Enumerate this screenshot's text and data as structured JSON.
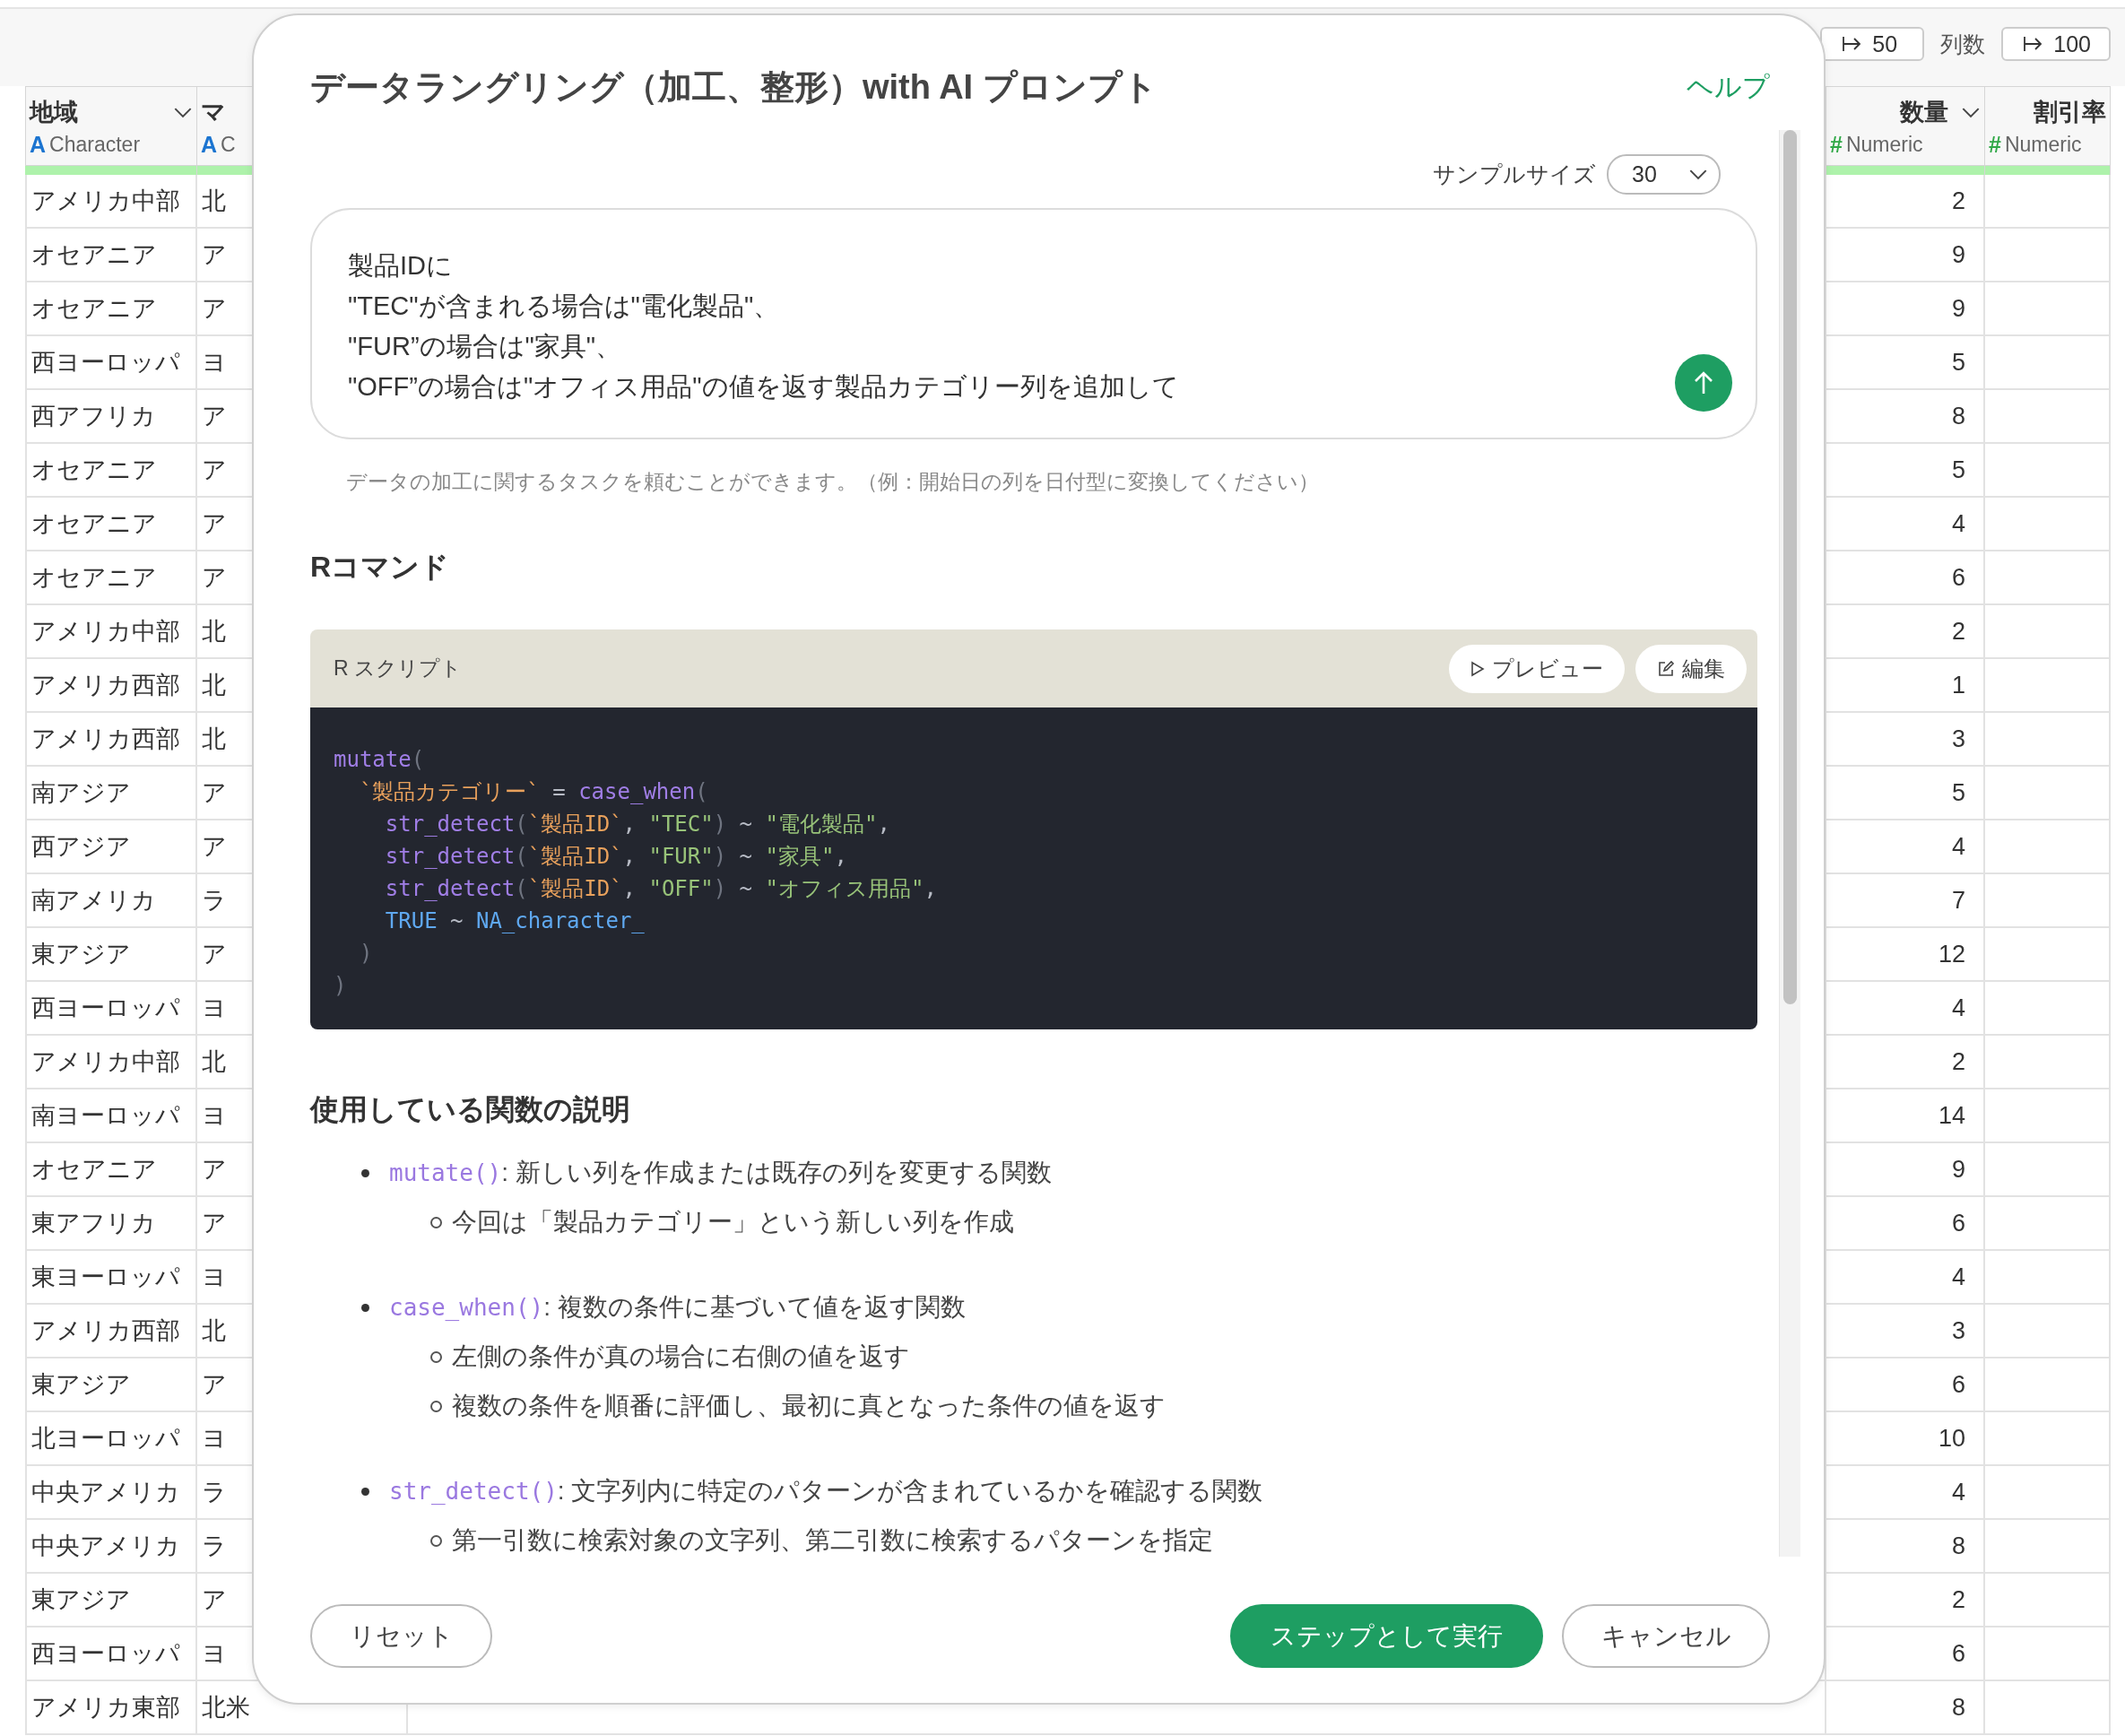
{
  "toolbar": {
    "rows_button": "50",
    "columns_label": "列数",
    "columns_button": "100"
  },
  "table": {
    "columns": [
      {
        "name": "地域",
        "type_icon": "A",
        "type": "Character",
        "kind": "character",
        "menu": true
      },
      {
        "name": "マ",
        "type_icon": "A",
        "type": "C",
        "kind": "character"
      },
      {
        "name": "数量",
        "type_icon": "#",
        "type": "Numeric",
        "kind": "numeric",
        "menu": true
      },
      {
        "name": "割引率",
        "type_icon": "#",
        "type": "Numeric",
        "kind": "numeric"
      }
    ],
    "rows": [
      [
        "アメリカ中部",
        "北",
        "2"
      ],
      [
        "オセアニア",
        "ア",
        "9"
      ],
      [
        "オセアニア",
        "ア",
        "9"
      ],
      [
        "西ヨーロッパ",
        "ヨ",
        "5"
      ],
      [
        "西アフリカ",
        "ア",
        "8"
      ],
      [
        "オセアニア",
        "ア",
        "5"
      ],
      [
        "オセアニア",
        "ア",
        "4"
      ],
      [
        "オセアニア",
        "ア",
        "6"
      ],
      [
        "アメリカ中部",
        "北",
        "2"
      ],
      [
        "アメリカ西部",
        "北",
        "1"
      ],
      [
        "アメリカ西部",
        "北",
        "3"
      ],
      [
        "南アジア",
        "ア",
        "5"
      ],
      [
        "西アジア",
        "ア",
        "4"
      ],
      [
        "南アメリカ",
        "ラ",
        "7"
      ],
      [
        "東アジア",
        "ア",
        "12"
      ],
      [
        "西ヨーロッパ",
        "ヨ",
        "4"
      ],
      [
        "アメリカ中部",
        "北",
        "2"
      ],
      [
        "南ヨーロッパ",
        "ヨ",
        "14"
      ],
      [
        "オセアニア",
        "ア",
        "9"
      ],
      [
        "東アフリカ",
        "ア",
        "6"
      ],
      [
        "東ヨーロッパ",
        "ヨ",
        "4"
      ],
      [
        "アメリカ西部",
        "北",
        "3"
      ],
      [
        "東アジア",
        "ア",
        "6"
      ],
      [
        "北ヨーロッパ",
        "ヨ",
        "10"
      ],
      [
        "中央アメリカ",
        "ラ",
        "4"
      ],
      [
        "中央アメリカ",
        "ラ",
        "8"
      ],
      [
        "東アジア",
        "ア",
        "2"
      ],
      [
        "西ヨーロッパ",
        "ヨ",
        "6"
      ],
      [
        "アメリカ東部",
        "北米",
        "8"
      ]
    ]
  },
  "dialog": {
    "title": "データラングリング（加工、整形）with AI プロンプト",
    "help_link": "ヘルプ",
    "sample_size": {
      "label": "サンプルサイズ",
      "value": "30"
    },
    "prompt": {
      "value": "製品IDに\n\"TEC\"が含まれる場合は\"電化製品\"、\n\"FUR”の場合は\"家具\"、\n\"OFF”の場合は\"オフィス用品\"の値を返す製品カテゴリー列を追加して"
    },
    "hint": "データの加工に関するタスクを頼むことができます。（例：開始日の列を日付型に変換してください）",
    "r_command": {
      "heading": "Rコマンド",
      "script_label": "R スクリプト",
      "buttons": [
        {
          "label": "プレビュー",
          "kind": "preview"
        },
        {
          "label": "編集",
          "kind": "edit"
        }
      ],
      "code": [
        [
          {
            "kind": "fn",
            "text": "mutate"
          },
          {
            "kind": "punct",
            "text": "("
          }
        ],
        [
          {
            "kind": "name",
            "text": "  `製品カテゴリー`"
          },
          {
            "kind": "op",
            "text": " = "
          },
          {
            "kind": "fn",
            "text": "case_when"
          },
          {
            "kind": "punct",
            "text": "("
          }
        ],
        [
          {
            "kind": "fn",
            "text": "    str_detect"
          },
          {
            "kind": "punct",
            "text": "("
          },
          {
            "kind": "name",
            "text": "`製品ID`"
          },
          {
            "kind": "op",
            "text": ", "
          },
          {
            "kind": "str",
            "text": "\"TEC\""
          },
          {
            "kind": "punct",
            "text": ")"
          },
          {
            "kind": "op",
            "text": " ~ "
          },
          {
            "kind": "str",
            "text": "\"電化製品\""
          },
          {
            "kind": "op",
            "text": ","
          }
        ],
        [
          {
            "kind": "fn",
            "text": "    str_detect"
          },
          {
            "kind": "punct",
            "text": "("
          },
          {
            "kind": "name",
            "text": "`製品ID`"
          },
          {
            "kind": "op",
            "text": ", "
          },
          {
            "kind": "str",
            "text": "\"FUR\""
          },
          {
            "kind": "punct",
            "text": ")"
          },
          {
            "kind": "op",
            "text": " ~ "
          },
          {
            "kind": "str",
            "text": "\"家具\""
          },
          {
            "kind": "op",
            "text": ","
          }
        ],
        [
          {
            "kind": "fn",
            "text": "    str_detect"
          },
          {
            "kind": "punct",
            "text": "("
          },
          {
            "kind": "name",
            "text": "`製品ID`"
          },
          {
            "kind": "op",
            "text": ", "
          },
          {
            "kind": "str",
            "text": "\"OFF\""
          },
          {
            "kind": "punct",
            "text": ")"
          },
          {
            "kind": "op",
            "text": " ~ "
          },
          {
            "kind": "str",
            "text": "\"オフィス用品\""
          },
          {
            "kind": "op",
            "text": ","
          }
        ],
        [
          {
            "kind": "const",
            "text": "    TRUE"
          },
          {
            "kind": "op",
            "text": " ~ "
          },
          {
            "kind": "const",
            "text": "NA_character_"
          }
        ],
        [
          {
            "kind": "punct",
            "text": "  )"
          }
        ],
        [
          {
            "kind": "punct",
            "text": ")"
          }
        ]
      ]
    },
    "explanation": {
      "heading": "使用している関数の説明",
      "items": [
        {
          "code": "mutate()",
          "text": ": 新しい列を作成または既存の列を変更する関数",
          "children": [
            "今回は「製品カテゴリー」という新しい列を作成"
          ]
        },
        {
          "code": "case_when()",
          "text": ": 複数の条件に基づいて値を返す関数",
          "children": [
            "左側の条件が真の場合に右側の値を返す",
            "複数の条件を順番に評価し、最初に真となった条件の値を返す"
          ]
        },
        {
          "code": "str_detect()",
          "text": ": 文字列内に特定のパターンが含まれているかを確認する関数",
          "children": [
            "第一引数に検索対象の文字列、第二引数に検索するパターンを指定"
          ]
        }
      ]
    },
    "footer": {
      "reset": "リセット",
      "run": "ステップとして実行",
      "cancel": "キャンセル"
    }
  }
}
